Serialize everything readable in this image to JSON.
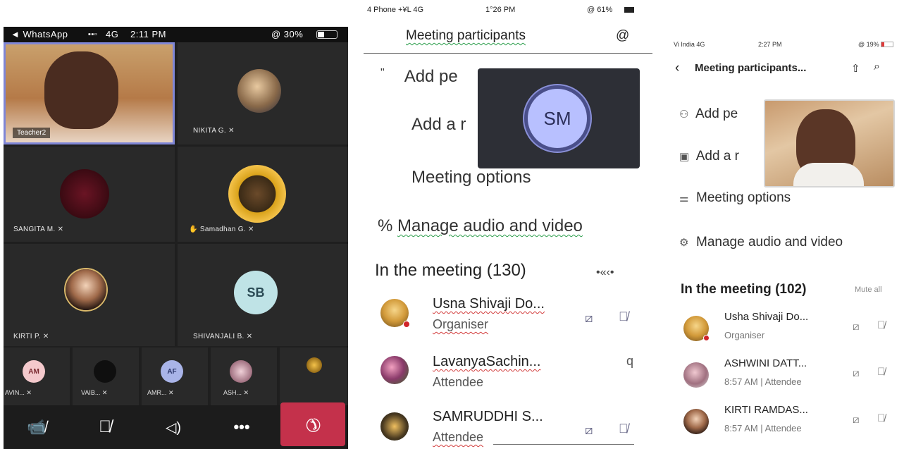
{
  "panel1": {
    "status": {
      "carrier": "◄ WhatsApp",
      "network": "4G",
      "time": "2:11 PM",
      "battery": "@ 30%"
    },
    "tiles": [
      {
        "name": "Teacher2"
      },
      {
        "name": "NIKITA G."
      },
      {
        "name": "SANGITA M."
      },
      {
        "name": "Samadhan G."
      },
      {
        "name": "KIRTI P."
      },
      {
        "name": "SHIVANJALI B.",
        "initials": "SB"
      }
    ],
    "thumbs": [
      {
        "label": "AVIN...",
        "initials": "AM"
      },
      {
        "label": "VAIB..."
      },
      {
        "label": "AMR...",
        "initials": "AF"
      },
      {
        "label": "ASH..."
      },
      {
        "label": ""
      }
    ],
    "colors": {
      "bg": "#1f1f1f",
      "tile": "#292929",
      "hangup": "#c4314b",
      "accent": "#6264a7"
    }
  },
  "panel2": {
    "status": {
      "carrier": "4 Phone +¥L 4G",
      "time": "1°26 PM",
      "battery": "@ 61%"
    },
    "header": {
      "title": "Meeting participants",
      "icon": "@"
    },
    "menu": [
      {
        "glyph": "\"",
        "label": "Add pe"
      },
      {
        "label": "Add a r"
      },
      {
        "label": "Meeting options"
      },
      {
        "glyph": "%",
        "label": "Manage audio and video"
      }
    ],
    "section": {
      "title": "In the meeting (130)",
      "action": "•«‹•"
    },
    "popup_initials": "SM",
    "participants": [
      {
        "name": "Usna Shivaji Do...",
        "role": "Organiser"
      },
      {
        "name": "LavanyaSachin...",
        "role": "Attendee",
        "icon": "q"
      },
      {
        "name": "SAMRUDDHI S...",
        "role": "Attendee"
      }
    ]
  },
  "panel3": {
    "status": {
      "carrier": "Vi India 4G",
      "time": "2:27 PM",
      "battery": "@ 19%"
    },
    "header": {
      "title": "Meeting participants..."
    },
    "menu": [
      {
        "icon": "people-icon",
        "label": "Add pe"
      },
      {
        "icon": "room-icon",
        "label": "Add a r"
      },
      {
        "icon": "sliders-icon",
        "label": "Meeting options"
      },
      {
        "icon": "gear-icon",
        "label": "Manage audio and video"
      }
    ],
    "section": {
      "title": "In the meeting (102)",
      "action": "Mute all"
    },
    "participants": [
      {
        "name": "Usha Shivaji Do...",
        "role": "Organiser"
      },
      {
        "name": "ASHWINI DATT...",
        "role": "8:57 AM | Attendee"
      },
      {
        "name": "KIRTI RAMDAS...",
        "role": "8:57 AM | Attendee"
      }
    ]
  }
}
